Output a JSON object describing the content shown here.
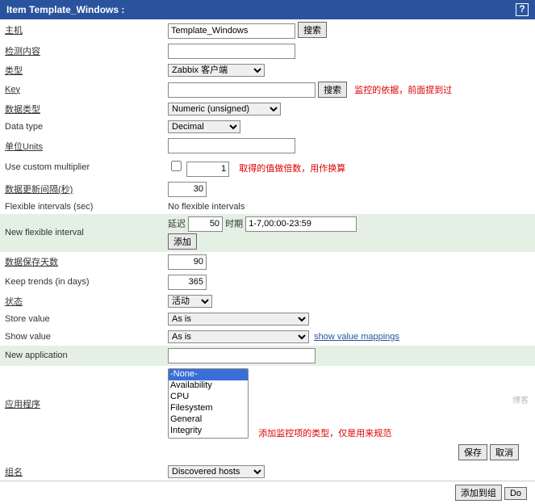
{
  "title": "Item Template_Windows :",
  "help": "?",
  "labels": {
    "host": "主机",
    "desc": "检测内容",
    "type": "类型",
    "key": "Key",
    "infotype": "数据类型",
    "datatype": "Data type",
    "units": "单位Units",
    "multiplier": "Use custom multiplier",
    "delay": "数据更新间隔(秒)",
    "flex": "Flexible intervals (sec)",
    "newflex": "New flexible interval",
    "history": "数据保存天数",
    "trends": "Keep trends (in days)",
    "status": "状态",
    "storev": "Store value",
    "showv": "Show value",
    "newapp": "New application",
    "apps": "应用程序",
    "groupname": "组名"
  },
  "values": {
    "host": "Template_Windows",
    "type": "Zabbix 客户端",
    "infotype": "Numeric (unsigned)",
    "datatype": "Decimal",
    "multval": "1",
    "delay": "30",
    "flexnone": "No flexible intervals",
    "flexdelaylbl": "延迟",
    "flexdelay": "50",
    "flexperiodlbl": "时期",
    "flexperiod": "1-7,00:00-23:59",
    "history": "90",
    "trends": "365",
    "status": "活动",
    "storev": "As is",
    "showv": "As is",
    "showmap": "show value mappings",
    "groupname": "Discovered hosts"
  },
  "applist": [
    "-None-",
    "Availability",
    "CPU",
    "Filesystem",
    "General",
    "Integrity"
  ],
  "buttons": {
    "search": "搜索",
    "add": "添加",
    "save": "保存",
    "cancel": "取消",
    "addlist": "添加到组",
    "do": "Do"
  },
  "annot": {
    "key": "监控的依据，前面提到过",
    "mult": "取得的值做倍数，用作换算",
    "apps": "添加监控项的类型，仅是用来规范"
  },
  "watermark": "博客"
}
